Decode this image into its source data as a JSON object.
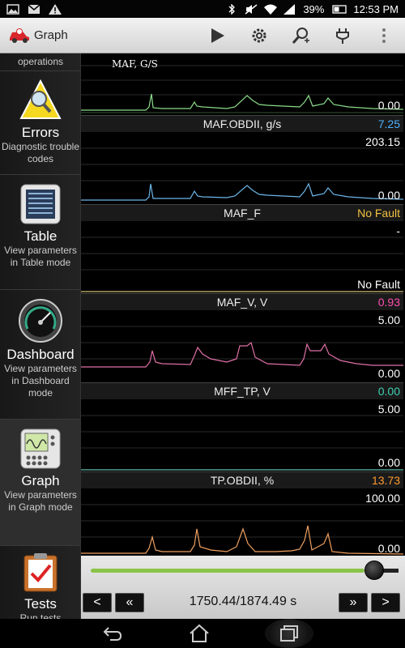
{
  "status": {
    "battery": "39%",
    "time": "12:53 PM"
  },
  "app": {
    "title": "Graph"
  },
  "sidebar": {
    "top_label": "operations",
    "items": [
      {
        "title": "Errors",
        "desc": "Diagnostic trouble codes"
      },
      {
        "title": "Table",
        "desc": "View parameters in Table mode"
      },
      {
        "title": "Dashboard",
        "desc": "View parameters in Dashboard mode"
      },
      {
        "title": "Graph",
        "desc": "View parameters in Graph mode"
      },
      {
        "title": "Tests",
        "desc": "Run tests"
      }
    ]
  },
  "panels": [
    {
      "name": "MAF, G/S",
      "value": "",
      "max": "",
      "min": "0.00",
      "color": "#8bdc8b",
      "valcolor": "#ffffff"
    },
    {
      "name": "MAF.OBDII, g/s",
      "value": "7.25",
      "max": "203.15",
      "min": "0.00",
      "color": "#6cb6e8",
      "valcolor": "#4fb3ff"
    },
    {
      "name": "MAF_F",
      "value": "No Fault",
      "max": "-",
      "min": "No Fault",
      "color": "#d8c27a",
      "valcolor": "#f0c040"
    },
    {
      "name": "MAF_V, V",
      "value": "0.93",
      "max": "5.00",
      "min": "0.00",
      "color": "#e070a8",
      "valcolor": "#ff4fb0"
    },
    {
      "name": "MFF_TP, V",
      "value": "0.00",
      "max": "5.00",
      "min": "0.00",
      "color": "#60c0b0",
      "valcolor": "#40d0b0"
    },
    {
      "name": "TP.OBDII, %",
      "value": "13.73",
      "max": "100.00",
      "min": "0.00",
      "color": "#f0a060",
      "valcolor": "#ff9a30"
    }
  ],
  "controls": {
    "time": "1750.44/1874.49 s",
    "position": 0.946,
    "prev": "<",
    "rewind": "«",
    "forward": "»",
    "next": ">"
  }
}
